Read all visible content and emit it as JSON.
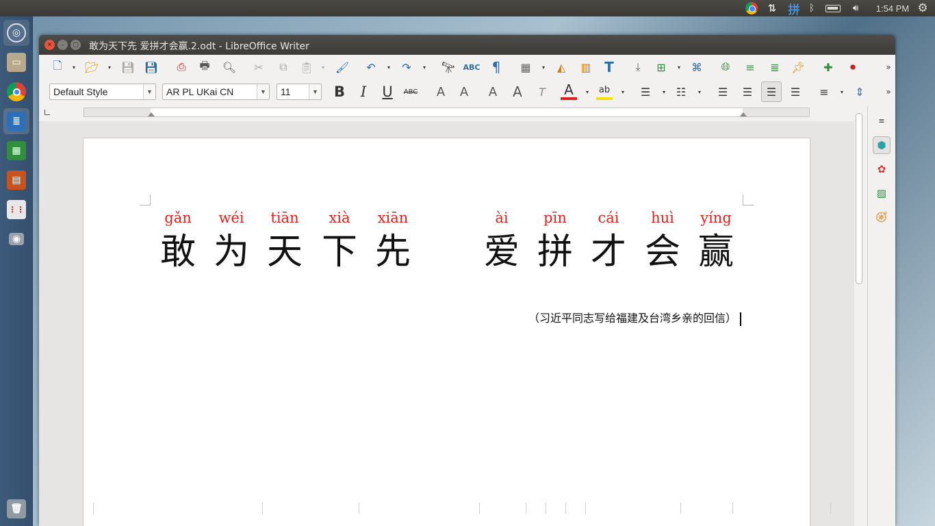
{
  "top_panel": {
    "time": "1:54 PM",
    "input_method": "拼",
    "icons": [
      "chrome-icon",
      "network-arrows-icon",
      "input-method-icon",
      "bluetooth-icon",
      "battery-icon",
      "volume-icon",
      "power-gear-icon"
    ]
  },
  "launcher": {
    "items": [
      "ubuntu-dash",
      "files",
      "chrome",
      "writer",
      "calc",
      "impress",
      "apps",
      "screenshot",
      "trash"
    ]
  },
  "window": {
    "title": "敢为天下先 爱拼才会赢.2.odt - LibreOffice Writer"
  },
  "formatting": {
    "paragraph_style": "Default Style",
    "font_name": "AR PL UKai CN",
    "font_size": "11"
  },
  "document": {
    "line1": [
      {
        "pinyin": "gǎn",
        "hanzi": "敢"
      },
      {
        "pinyin": "wéi",
        "hanzi": "为"
      },
      {
        "pinyin": "tiān",
        "hanzi": "天"
      },
      {
        "pinyin": "xià",
        "hanzi": "下"
      },
      {
        "pinyin": "xiān",
        "hanzi": "先"
      }
    ],
    "line2": [
      {
        "pinyin": "ài",
        "hanzi": "爱"
      },
      {
        "pinyin": "pīn",
        "hanzi": "拼"
      },
      {
        "pinyin": "cái",
        "hanzi": "才"
      },
      {
        "pinyin": "huì",
        "hanzi": "会"
      },
      {
        "pinyin": "yíng",
        "hanzi": "赢"
      }
    ],
    "caption": "（习近平同志写给福建及台湾乡亲的回信）"
  },
  "colors": {
    "pinyin": "#e0201b",
    "launcher": "#3d5a7a"
  }
}
